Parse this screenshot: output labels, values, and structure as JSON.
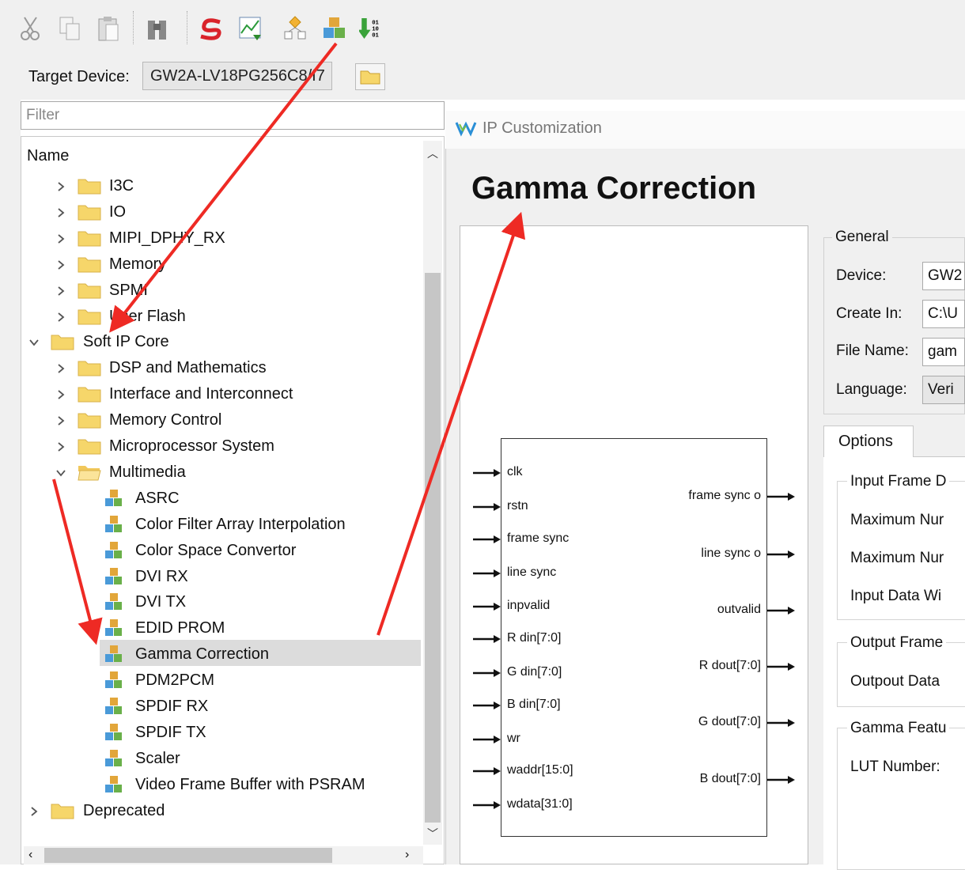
{
  "toolbar": {
    "icons": [
      "cut-icon",
      "copy-icon",
      "paste-icon",
      "binoculars-icon",
      "synthesize-icon",
      "timing-icon",
      "floorplanner-icon",
      "ip-core-generator-icon",
      "program-device-icon"
    ]
  },
  "target": {
    "label": "Target Device:",
    "value": "GW2A-LV18PG256C8/I7"
  },
  "filter": {
    "placeholder": "Filter"
  },
  "tree": {
    "header": "Name",
    "items": [
      {
        "label": "I3C"
      },
      {
        "label": "IO"
      },
      {
        "label": "MIPI_DPHY_RX"
      },
      {
        "label": "Memory"
      },
      {
        "label": "SPMI"
      },
      {
        "label": "User Flash"
      },
      {
        "label": "Soft IP Core"
      },
      {
        "label": "DSP and Mathematics"
      },
      {
        "label": "Interface and Interconnect"
      },
      {
        "label": "Memory Control"
      },
      {
        "label": "Microprocessor System"
      },
      {
        "label": "Multimedia"
      },
      {
        "label": "ASRC"
      },
      {
        "label": "Color Filter Array Interpolation"
      },
      {
        "label": "Color Space Convertor"
      },
      {
        "label": "DVI RX"
      },
      {
        "label": "DVI TX"
      },
      {
        "label": "EDID PROM"
      },
      {
        "label": "Gamma Correction"
      },
      {
        "label": "PDM2PCM"
      },
      {
        "label": "SPDIF RX"
      },
      {
        "label": "SPDIF TX"
      },
      {
        "label": "Scaler"
      },
      {
        "label": "Video Frame Buffer with PSRAM"
      },
      {
        "label": "Deprecated"
      }
    ]
  },
  "dialog": {
    "title": "IP Customization",
    "ip_name": "Gamma Correction",
    "inputs": [
      "clk",
      "rstn",
      "frame sync",
      "line sync",
      "inpvalid",
      "R din[7:0]",
      "G din[7:0]",
      "B din[7:0]",
      "wr",
      "waddr[15:0]",
      "wdata[31:0]"
    ],
    "outputs": [
      "frame sync o",
      "line sync o",
      "outvalid",
      "R dout[7:0]",
      "G dout[7:0]",
      "B dout[7:0]"
    ],
    "general": {
      "title": "General",
      "device_label": "Device:",
      "device_value": "GW2",
      "create_in_label": "Create In:",
      "create_in_value": "C:\\U",
      "file_name_label": "File Name:",
      "file_name_value": "gam",
      "language_label": "Language:",
      "language_value": "Veri"
    },
    "options_tab": "Options",
    "groups": {
      "input_frame": "Input Frame D",
      "max_num_1": "Maximum Nur",
      "max_num_2": "Maximum Nur",
      "input_data_width": "Input Data Wi",
      "output_frame": "Output Frame",
      "output_data": "Outpout Data",
      "gamma_feature": "Gamma Featu",
      "lut_number": "LUT Number:"
    }
  },
  "colors": {
    "arrow": "#ee2a24",
    "selection": "#dcdcdc",
    "folder": "#f6d66a"
  }
}
